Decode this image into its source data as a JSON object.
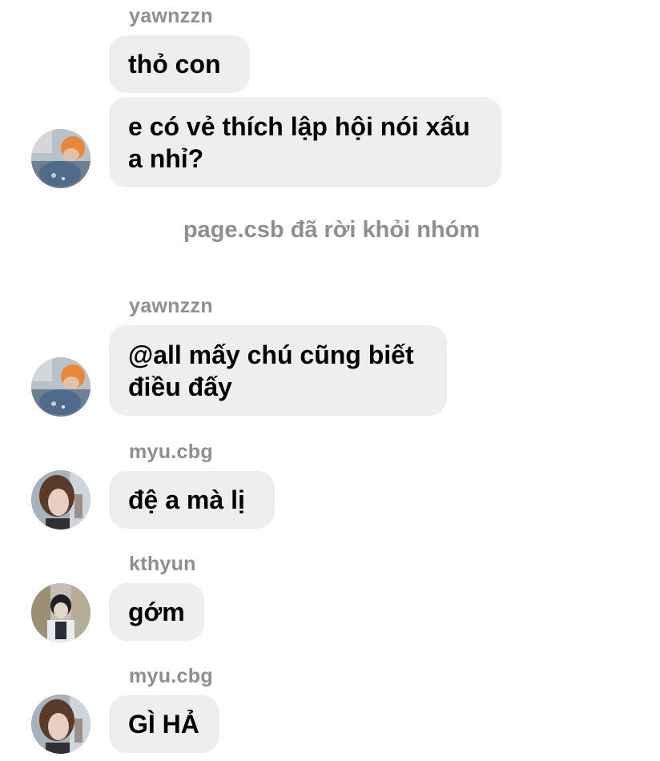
{
  "messages": [
    {
      "sender": "yawnzzn",
      "text": "thỏ con"
    },
    {
      "text": "e có vẻ thích lập hội nói xấu a nhỉ?",
      "avatar": "orange-hair-avatar-icon"
    },
    {
      "system": "page.csb đã rời khỏi nhóm"
    },
    {
      "sender": "yawnzzn",
      "text": "@all mấy chú cũng biết điều đấy",
      "avatar": "orange-hair-avatar-icon"
    },
    {
      "sender": "myu.cbg",
      "text": "đệ a mà lị",
      "avatar": "brown-hair-avatar-icon"
    },
    {
      "sender": "kthyun",
      "text": "gớm",
      "avatar": "dark-hair-avatar-icon"
    },
    {
      "sender": "myu.cbg",
      "text": "GÌ HẢ",
      "avatar": "brown-hair-avatar-icon"
    }
  ],
  "colors": {
    "bubble_bg": "#eeeef1",
    "sender_text": "#8e8e93",
    "message_text": "#000000",
    "background": "#ffffff"
  }
}
